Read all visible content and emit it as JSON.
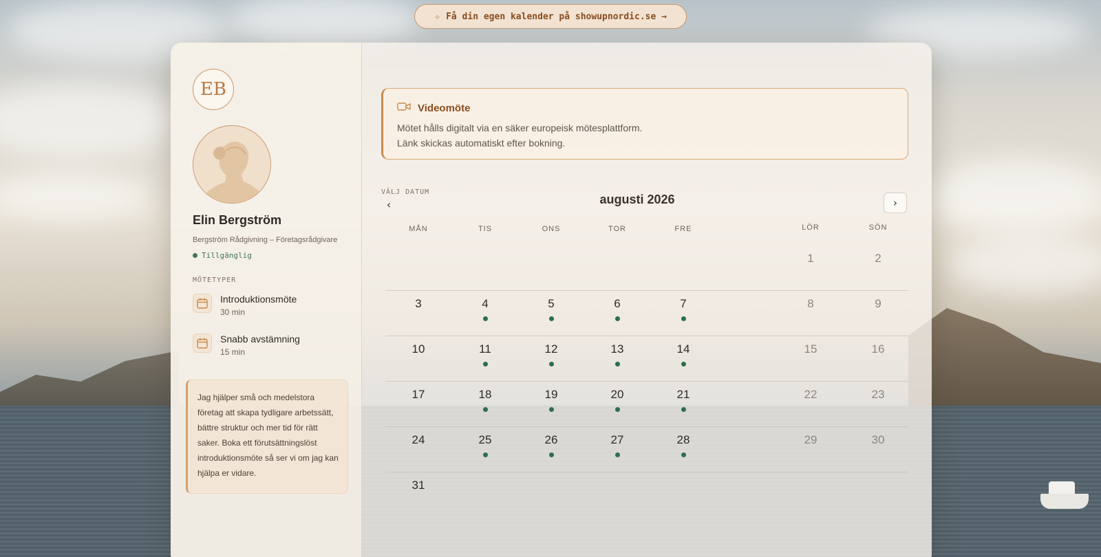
{
  "promo": {
    "text": "Få din egen kalender på showupnordic.se →"
  },
  "profile": {
    "initials": "EB",
    "name": "Elin Bergström",
    "company": "Bergström Rådgivning – Företagsrådgivare",
    "status": "Tillgänglig",
    "status_color": "#3b7a55"
  },
  "meeting_types": {
    "label": "MÖTETYPER",
    "items": [
      {
        "title": "Introduktionsmöte",
        "duration": "30 min",
        "icon": "calendar-icon"
      },
      {
        "title": "Snabb avstämning",
        "duration": "15 min",
        "icon": "calendar-icon"
      }
    ]
  },
  "about": {
    "text": "Jag hjälper små och medelstora företag att skapa tydligare arbetssätt, bättre struktur och mer tid för rätt saker. Boka ett förutsättningslöst introduktionsmöte så ser vi om jag kan hjälpa er vidare."
  },
  "video": {
    "title": "Videomöte",
    "line1": "Mötet hålls digitalt via en säker europeisk mötesplattform.",
    "line2": "Länk skickas automatiskt efter bokning.",
    "icon": "video-camera-icon"
  },
  "calendar": {
    "label": "VÄLJ DATUM",
    "month": "augusti 2026",
    "weekdays": [
      "MÅN",
      "TIS",
      "ONS",
      "TOR",
      "FRE",
      "LÖR",
      "SÖN"
    ],
    "weeks": [
      [
        null,
        null,
        null,
        null,
        null,
        {
          "d": "1",
          "a": false
        },
        {
          "d": "2",
          "a": false
        }
      ],
      [
        {
          "d": "3",
          "a": false
        },
        {
          "d": "4",
          "a": true
        },
        {
          "d": "5",
          "a": true
        },
        {
          "d": "6",
          "a": true
        },
        {
          "d": "7",
          "a": true
        },
        {
          "d": "8",
          "a": false
        },
        {
          "d": "9",
          "a": false
        }
      ],
      [
        {
          "d": "10",
          "a": false
        },
        {
          "d": "11",
          "a": true
        },
        {
          "d": "12",
          "a": true
        },
        {
          "d": "13",
          "a": true
        },
        {
          "d": "14",
          "a": true
        },
        {
          "d": "15",
          "a": false
        },
        {
          "d": "16",
          "a": false
        }
      ],
      [
        {
          "d": "17",
          "a": false
        },
        {
          "d": "18",
          "a": true
        },
        {
          "d": "19",
          "a": true
        },
        {
          "d": "20",
          "a": true
        },
        {
          "d": "21",
          "a": true
        },
        {
          "d": "22",
          "a": false
        },
        {
          "d": "23",
          "a": false
        }
      ],
      [
        {
          "d": "24",
          "a": false
        },
        {
          "d": "25",
          "a": true
        },
        {
          "d": "26",
          "a": true
        },
        {
          "d": "27",
          "a": true
        },
        {
          "d": "28",
          "a": true
        },
        {
          "d": "29",
          "a": false
        },
        {
          "d": "30",
          "a": false
        }
      ],
      [
        {
          "d": "31",
          "a": false
        },
        null,
        null,
        null,
        null,
        null,
        null
      ]
    ],
    "available_color": "#2f6e4b",
    "accent": "#c98a4e"
  }
}
